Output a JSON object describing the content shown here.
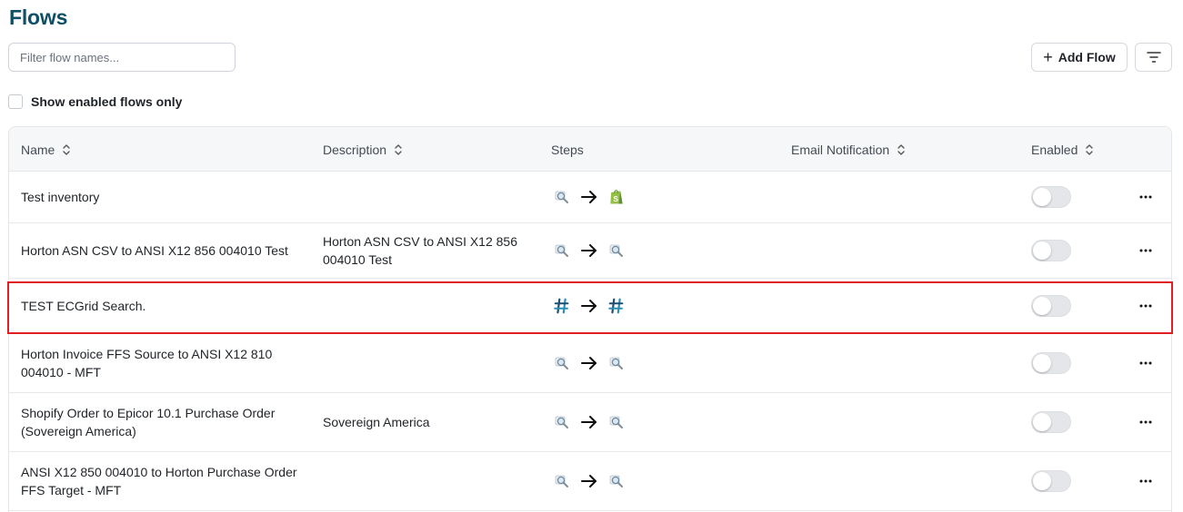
{
  "page": {
    "title": "Flows"
  },
  "filter": {
    "placeholder": "Filter flow names..."
  },
  "toolbar": {
    "add_flow_label": "Add Flow",
    "add_icon": "plus-icon",
    "filter_icon": "filter-lines-icon"
  },
  "enabled_only": {
    "label": "Show enabled flows only",
    "checked": false
  },
  "table": {
    "columns": {
      "name": "Name",
      "description": "Description",
      "steps": "Steps",
      "email_notification": "Email Notification",
      "enabled": "Enabled"
    },
    "rows": [
      {
        "name": "Test inventory",
        "description": "",
        "steps": [
          "search-connector-icon",
          "shopify-icon"
        ],
        "enabled": false
      },
      {
        "name": "Horton ASN CSV to ANSI X12 856 004010 Test",
        "description": "Horton ASN CSV to ANSI X12 856 004010 Test",
        "steps": [
          "search-connector-icon",
          "search-connector-icon"
        ],
        "enabled": false
      },
      {
        "name": "TEST ECGrid Search.",
        "description": "",
        "steps": [
          "ecgrid-icon",
          "ecgrid-icon"
        ],
        "enabled": false,
        "highlighted": true
      },
      {
        "name": "Horton Invoice FFS Source to ANSI X12 810 004010 - MFT",
        "description": "",
        "steps": [
          "search-connector-icon",
          "search-connector-icon"
        ],
        "enabled": false
      },
      {
        "name": "Shopify Order to Epicor 10.1 Purchase Order (Sovereign America)",
        "description": "Sovereign America",
        "steps": [
          "search-connector-icon",
          "search-connector-icon"
        ],
        "enabled": false
      },
      {
        "name": "ANSI X12 850 004010 to Horton Purchase Order FFS Target - MFT",
        "description": "",
        "steps": [
          "search-connector-icon",
          "search-connector-icon"
        ],
        "enabled": false
      }
    ]
  },
  "colors": {
    "title": "#0e4f66",
    "highlight": "#e02020",
    "shopify": "#95bf47",
    "ecgrid": "#1b6e8c"
  }
}
